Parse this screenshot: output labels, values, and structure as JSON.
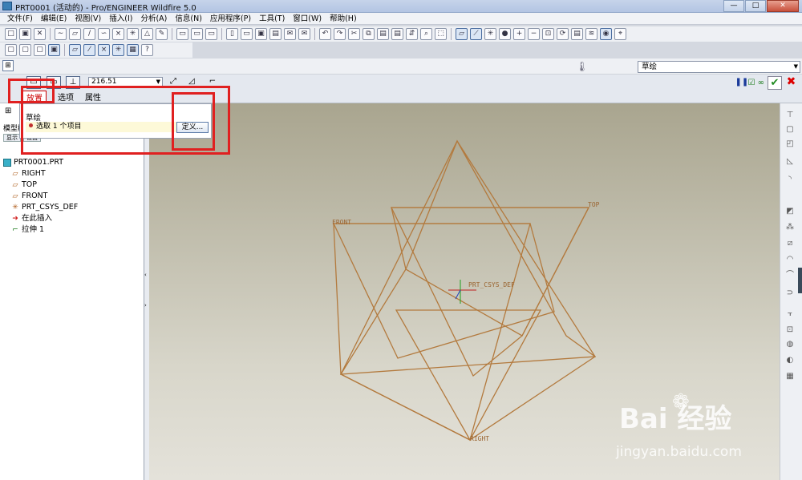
{
  "window": {
    "title": "PRT0001 (活动的) - Pro/ENGINEER Wildfire 5.0",
    "min": "—",
    "max": "□",
    "close": "✕"
  },
  "menu": [
    "文件(F)",
    "编辑(E)",
    "视图(V)",
    "插入(I)",
    "分析(A)",
    "信息(N)",
    "应用程序(P)",
    "工具(T)",
    "窗口(W)",
    "帮助(H)"
  ],
  "ribbon": {
    "mode_select": "草绘"
  },
  "dashboard": {
    "depth_value": "216.51",
    "tabs": [
      "放置",
      "选项",
      "属性"
    ],
    "active_tab": "放置"
  },
  "placement_panel": {
    "label": "草绘",
    "selection_text": "选取 1 个项目",
    "define_button": "定义..."
  },
  "model_tree": {
    "tab_label": "模型树",
    "buttons": [
      "显示",
      "设置"
    ],
    "root": "PRT0001.PRT",
    "items": [
      "RIGHT",
      "TOP",
      "FRONT",
      "PRT_CSYS_DEF",
      "在此插入",
      "拉伸 1"
    ]
  },
  "viewport": {
    "labels": {
      "front": "FRONT",
      "top": "TOP",
      "right": "RIGHT",
      "csys": "PRT_CSYS_DEF"
    }
  },
  "watermark": {
    "brand": "Bai  经验",
    "url": "jingyan.baidu.com"
  },
  "colors": {
    "datum": "#b37a3e",
    "highlight": "#e02020",
    "canvas_top": "#a9a58f",
    "canvas_bottom": "#e4e2da"
  }
}
